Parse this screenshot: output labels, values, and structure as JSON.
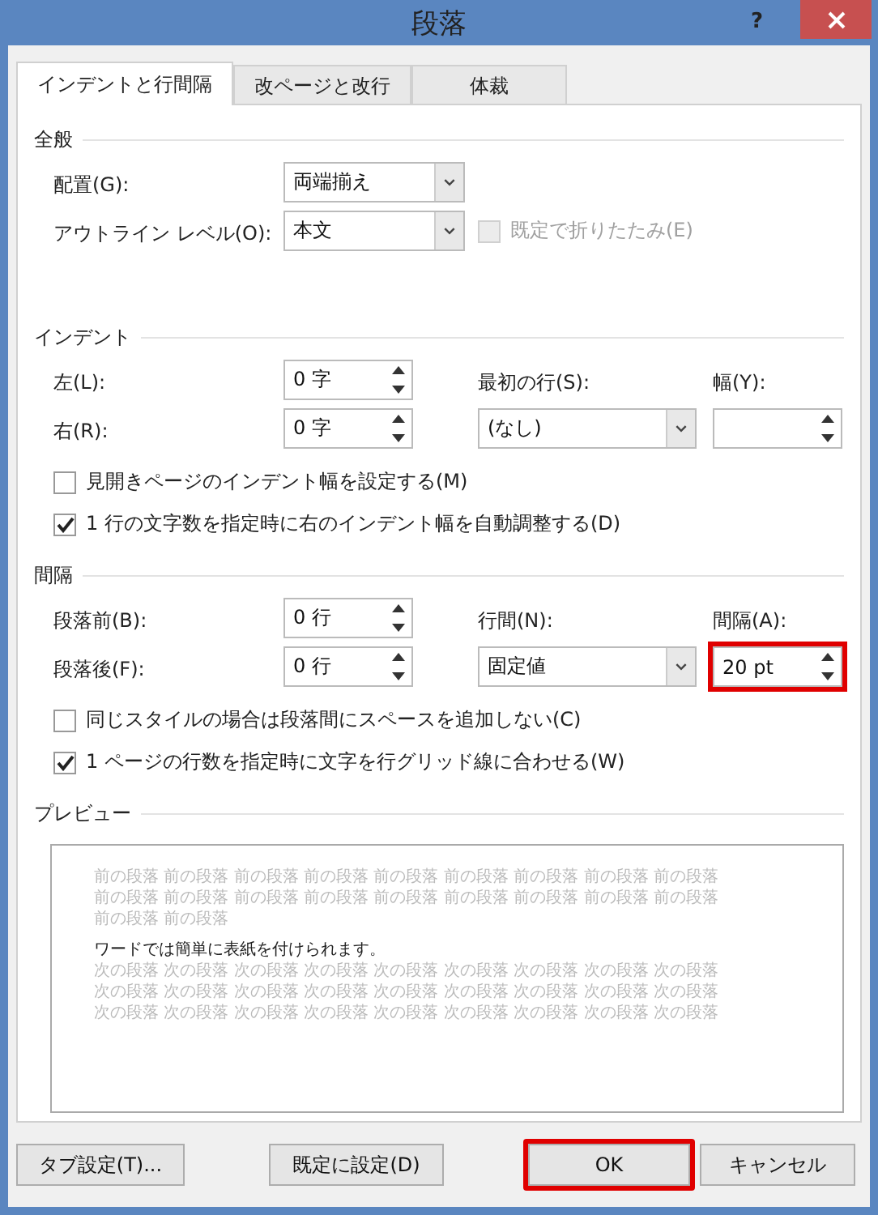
{
  "window": {
    "title": "段落",
    "help": "?"
  },
  "tabs": [
    {
      "label": "インデントと行間隔",
      "selected": true
    },
    {
      "label": "改ページと改行",
      "selected": false
    },
    {
      "label": "体裁",
      "selected": false
    }
  ],
  "sections": [
    {
      "title": "全般",
      "rows": [
        [
          {
            "kind": "label",
            "text": "配置(G):"
          },
          {
            "kind": "dropdown",
            "value": "両端揃え"
          }
        ],
        [
          {
            "kind": "label",
            "text": "アウトライン レベル(O):"
          },
          {
            "kind": "dropdown",
            "value": "本文"
          },
          {
            "kind": "checkbox",
            "text": "既定で折りたたみ(E)",
            "checked": false,
            "disabled": true
          }
        ]
      ]
    },
    {
      "title": "インデント",
      "rows": [
        [
          {
            "kind": "label",
            "text": "左(L):"
          },
          {
            "kind": "spinner",
            "value": "0 字",
            "highlighted": false
          },
          {
            "kind": "label",
            "text": "最初の行(S):"
          },
          {
            "kind": "label",
            "text": "幅(Y):"
          }
        ],
        [
          {
            "kind": "label",
            "text": "右(R):"
          },
          {
            "kind": "spinner",
            "value": "0 字",
            "highlighted": false
          },
          {
            "kind": "dropdown",
            "value": "(なし)"
          },
          {
            "kind": "spinner",
            "highlighted": false
          }
        ]
      ],
      "options": [
        {
          "text": "見開きページのインデント幅を設定する(M)",
          "checked": false
        },
        {
          "text": "1 行の文字数を指定時に右のインデント幅を自動調整する(D)",
          "checked": true
        }
      ]
    },
    {
      "title": "間隔",
      "rows": [
        [
          {
            "kind": "label",
            "text": "段落前(B):"
          },
          {
            "kind": "spinner",
            "value": "0 行",
            "highlighted": false
          },
          {
            "kind": "label",
            "text": "行間(N):"
          },
          {
            "kind": "label",
            "text": "間隔(A):"
          }
        ],
        [
          {
            "kind": "label",
            "text": "段落後(F):"
          },
          {
            "kind": "spinner",
            "value": "0 行",
            "highlighted": false
          },
          {
            "kind": "dropdown",
            "value": "固定値"
          },
          {
            "kind": "spinner",
            "value": "20 pt",
            "highlighted": true
          }
        ]
      ],
      "options": [
        {
          "text": "同じスタイルの場合は段落間にスペースを追加しない(C)",
          "checked": false
        },
        {
          "text": "1 ページの行数を指定時に文字を行グリッド線に合わせる(W)",
          "checked": true
        }
      ]
    }
  ],
  "preview": {
    "title": "プレビュー",
    "before": [
      "前の段落 前の段落 前の段落 前の段落 前の段落 前の段落 前の段落 前の段落 前の段落",
      "前の段落 前の段落 前の段落 前の段落 前の段落 前の段落 前の段落 前の段落 前の段落",
      "前の段落 前の段落"
    ],
    "sample": "ワードでは簡単に表紙を付けられます。",
    "after": [
      "次の段落 次の段落 次の段落 次の段落 次の段落 次の段落 次の段落 次の段落 次の段落",
      "次の段落 次の段落 次の段落 次の段落 次の段落 次の段落 次の段落 次の段落 次の段落",
      "次の段落 次の段落 次の段落 次の段落 次の段落 次の段落 次の段落 次の段落 次の段落"
    ]
  },
  "buttons": [
    {
      "label": "タブ設定(T)...",
      "highlighted": false
    },
    {
      "label": "既定に設定(D)",
      "highlighted": false
    },
    {
      "label": "OK",
      "highlighted": true
    },
    {
      "label": "キャンセル",
      "highlighted": false
    }
  ]
}
